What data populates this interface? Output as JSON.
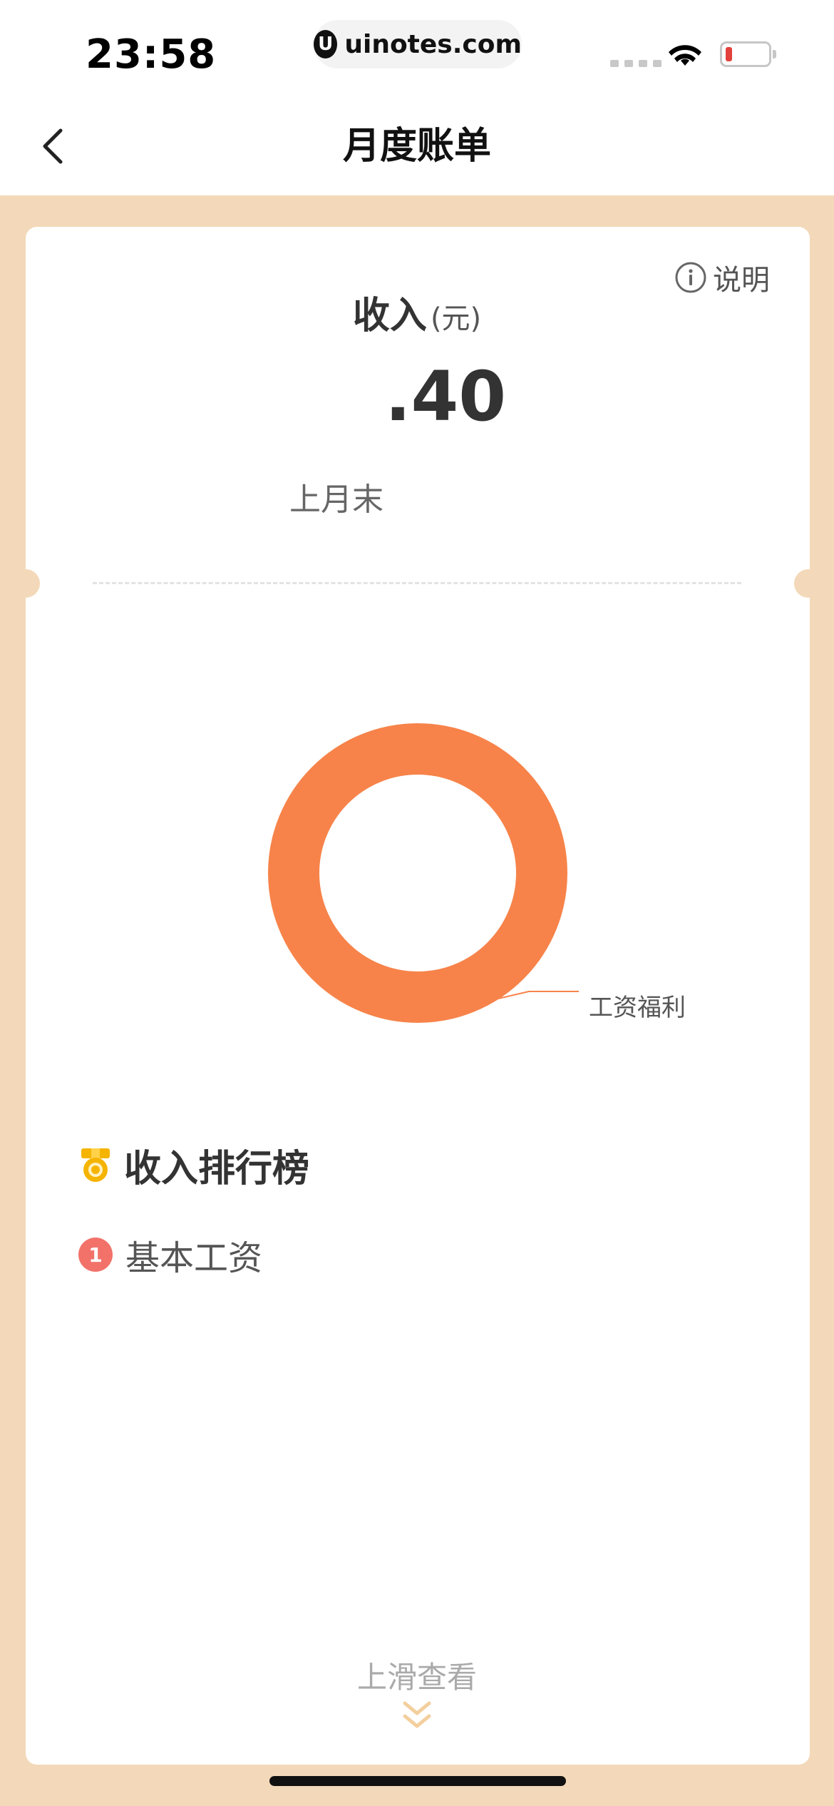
{
  "status_bar": {
    "time": "23:58",
    "url_logo": "U",
    "url": "uinotes.com",
    "battery_color": "#e2413c"
  },
  "nav": {
    "title": "月度账单",
    "back_icon": "chevron-left-icon"
  },
  "summary": {
    "help_label": "说明",
    "help_icon": "info-icon",
    "title": "收入",
    "unit": "(元)",
    "amount": ".40",
    "period": "上月末"
  },
  "chart_data": {
    "type": "pie",
    "donut": true,
    "slices": [
      {
        "label": "工资福利",
        "value": 100,
        "color": "#f7834a"
      }
    ]
  },
  "ranking": {
    "title": "收入排行榜",
    "icon": "medal-icon",
    "items": [
      {
        "rank": "1",
        "label": "基本工资"
      }
    ]
  },
  "footer": {
    "swipe_hint": "上滑查看",
    "arrow_icon": "double-chevron-down-icon",
    "accent": "#f3d9b9"
  }
}
